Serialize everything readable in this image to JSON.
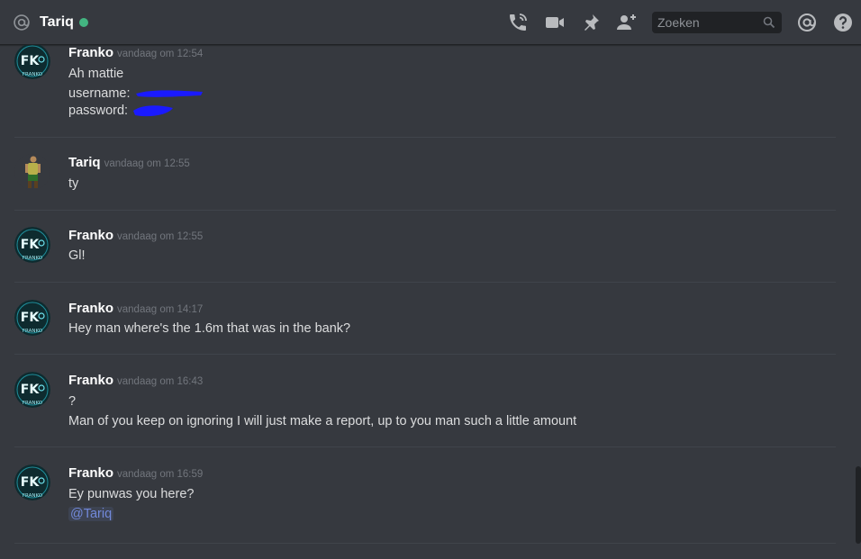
{
  "header": {
    "channel_name": "Tariq",
    "status_color": "#43b581",
    "search_placeholder": "Zoeken",
    "icons": [
      "at-sign-icon",
      "call-icon",
      "video-icon",
      "pin-icon",
      "add-friend-icon",
      "search-icon",
      "mention-icon",
      "help-icon"
    ]
  },
  "messages": [
    {
      "author": "Franko",
      "timestamp": "vandaag om 12:54",
      "lines": [
        "Ah mattie",
        "username:",
        "password:"
      ]
    },
    {
      "author": "Tariq",
      "timestamp": "vandaag om 12:55",
      "lines": [
        "ty"
      ]
    },
    {
      "author": "Franko",
      "timestamp": "vandaag om 12:55",
      "lines": [
        "Gl!"
      ]
    },
    {
      "author": "Franko",
      "timestamp": "vandaag om 14:17",
      "lines": [
        "Hey man where's the 1.6m that was in the bank?"
      ]
    },
    {
      "author": "Franko",
      "timestamp": "vandaag om 16:43",
      "lines": [
        "?",
        "Man of you keep on ignoring I will just make a report, up to you man such a little amount"
      ]
    },
    {
      "author": "Franko",
      "timestamp": "vandaag om 16:59",
      "lines": [
        "Ey punwas you here?"
      ],
      "mention": "@Tariq"
    }
  ],
  "avatar_text": {
    "franko_top": "FK",
    "franko_bottom": "FRANKO"
  },
  "colors": {
    "background": "#36393f",
    "mention": "#7289da",
    "redaction": "#1a1aff"
  }
}
